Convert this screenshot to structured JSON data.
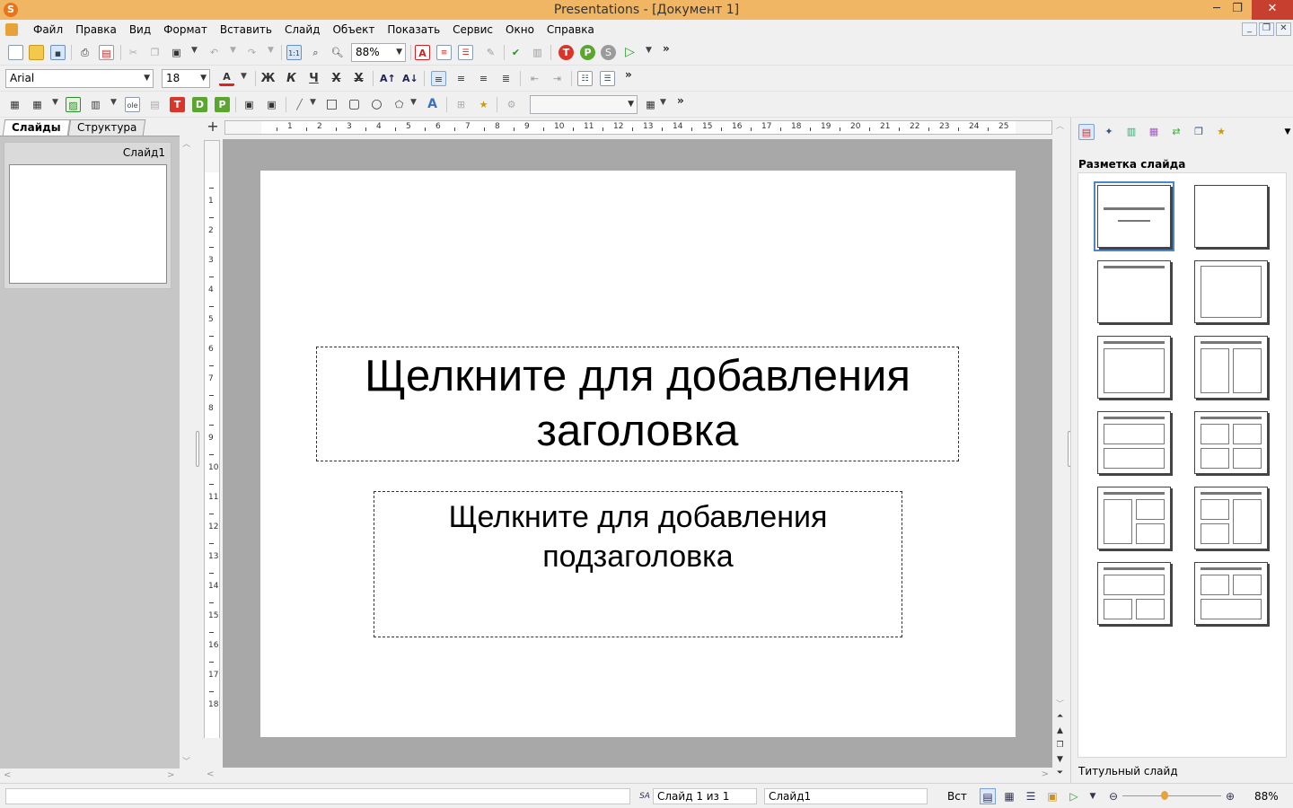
{
  "window": {
    "title": "Presentations - [Документ 1]",
    "app_icon": "S",
    "minimize": "─",
    "restore": "❐",
    "close": "✕"
  },
  "menu": {
    "items": [
      "Файл",
      "Правка",
      "Вид",
      "Формат",
      "Вставить",
      "Слайд",
      "Объект",
      "Показать",
      "Сервис",
      "Окно",
      "Справка"
    ]
  },
  "toolbar": {
    "zoom": "88%",
    "font_name": "Arial",
    "font_size": "18",
    "bold": "Ж",
    "italic": "К",
    "underline": "Ч",
    "strike": "Х",
    "double_strike": "Х",
    "more": "»"
  },
  "slides_panel": {
    "tabs": [
      "Слайды",
      "Структура"
    ],
    "thumbnails": [
      {
        "label": "Слайд1"
      }
    ]
  },
  "slide": {
    "title_placeholder": "Щелкните для добавления заголовка",
    "subtitle_placeholder": "Щелкните для добавления подзаголовка"
  },
  "ruler": {
    "h_numbers": [
      "1",
      "2",
      "3",
      "4",
      "5",
      "6",
      "7",
      "8",
      "9",
      "10",
      "11",
      "12",
      "13",
      "14",
      "15",
      "16",
      "17",
      "18",
      "19",
      "20",
      "21",
      "22",
      "23",
      "24",
      "25"
    ],
    "v_numbers": [
      "1",
      "2",
      "3",
      "4",
      "5",
      "6",
      "7",
      "8",
      "9",
      "10",
      "11",
      "12",
      "13",
      "14",
      "15",
      "16",
      "17",
      "18"
    ]
  },
  "right_panel": {
    "title": "Разметка слайда",
    "caption": "Титульный слайд"
  },
  "status": {
    "slide_counter": "Слайд 1 из 1",
    "slide_name": "Слайд1",
    "insert_mode": "Вст",
    "zoom": "88%"
  }
}
